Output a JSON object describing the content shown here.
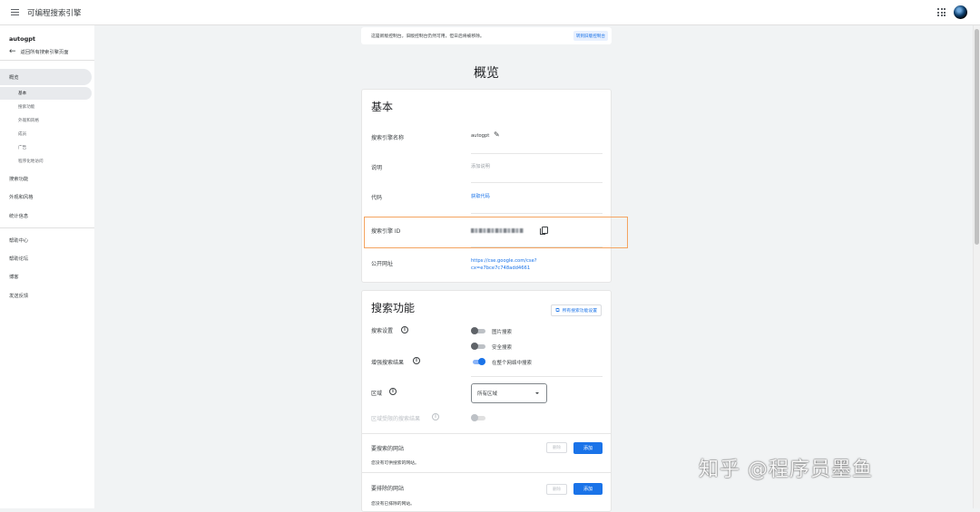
{
  "header": {
    "title": "可编程搜索引擎"
  },
  "sidebar": {
    "project": "autogpt",
    "back_label": "返回所有搜索引擎页面",
    "overview": "概览",
    "sub_items": [
      "基本",
      "搜索功能",
      "外观和风格",
      "成员",
      "广告",
      "程序化地访问"
    ],
    "items": [
      "搜索功能",
      "外观和风格",
      "统计信息"
    ],
    "footer_items": [
      "帮助中心",
      "帮助论坛",
      "博客",
      "发送反馈"
    ]
  },
  "notice": {
    "text": "这是新版控制台。旧版控制台仍然可用，但日后将被移除。",
    "button": "转到旧版控制台"
  },
  "page_title": "概览",
  "basic": {
    "title": "基本",
    "name_label": "搜索引擎名称",
    "name_value": "autogpt",
    "desc_label": "说明",
    "desc_value": "添加说明",
    "code_label": "代码",
    "code_value": "获取代码",
    "id_label": "搜索引擎 ID",
    "public_url_label": "公开网址",
    "public_url_line1": "https://cse.google.com/cse?",
    "public_url_line2": "cx=e7bce7c748add4661"
  },
  "search_features": {
    "title": "搜索功能",
    "all_settings_button": "所有搜索功能设置",
    "search_settings_label": "搜索设置",
    "image_search": "图片搜索",
    "safe_search": "安全搜索",
    "enhance_label": "增强搜索结果",
    "whole_web": "在整个网络中搜索",
    "region_label": "区域",
    "region_value": "所有区域",
    "region_restrict_label": "区域受限的搜索结果",
    "sites_to_search_label": "要搜索的网站",
    "sites_to_search_empty": "您没有可供搜索的网站。",
    "sites_to_exclude_label": "要排除的网站",
    "sites_to_exclude_empty": "您没有已排除的网站。",
    "delete": "删除",
    "add": "添加"
  },
  "watermark": "知乎 @程序员墨鱼",
  "colors": {
    "accent": "#1a73e8",
    "highlight_border": "#f4a460",
    "background": "#f1f3f4"
  }
}
